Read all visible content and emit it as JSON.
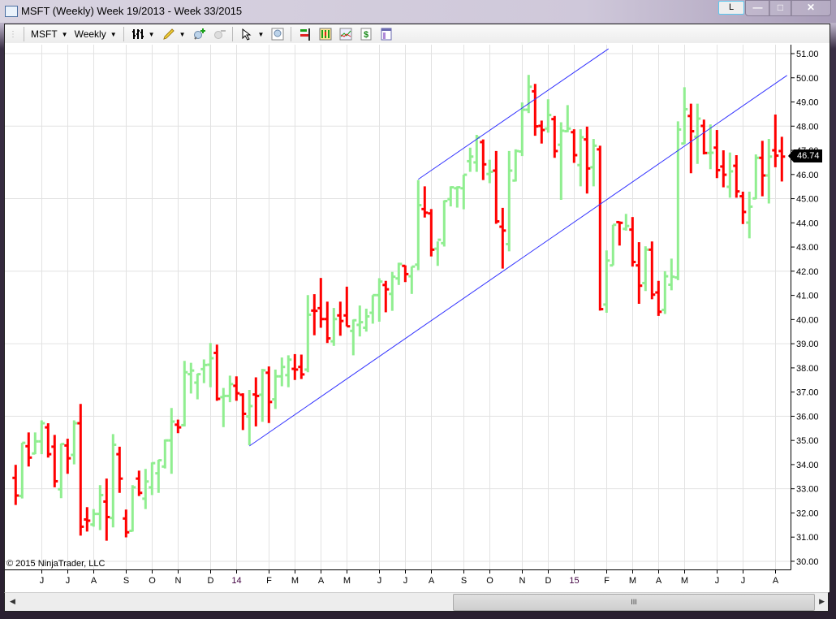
{
  "window": {
    "title": "MSFT (Weekly)  Week 19/2013 - Week 33/2015",
    "l_button": "L",
    "minimize": "—",
    "maximize": "□",
    "close": "✕"
  },
  "toolbar": {
    "instrument": "MSFT",
    "period": "Weekly",
    "icons": [
      "bar-type-icon",
      "pencil-draw-icon",
      "zoom-in-icon",
      "zoom-out-icon",
      "cursor-icon",
      "zoom-box-icon",
      "indicators-icon",
      "strategies-icon",
      "chart-style-icon",
      "dollar-icon",
      "properties-icon"
    ]
  },
  "copyright": "© 2015 NinjaTrader, LLC",
  "scroll_thumb": "III",
  "colors": {
    "up": "#90EE90",
    "down": "#FF0000",
    "trendline": "#3333FF",
    "grid": "#E2E2E2"
  },
  "chart_data": {
    "type": "ohlc",
    "symbol": "MSFT",
    "interval": "Weekly",
    "range": "Week 19/2013 - Week 33/2015",
    "last_price": "46.74",
    "ylim": [
      30,
      51
    ],
    "y_ticks": [
      "30.00",
      "31.00",
      "32.00",
      "33.00",
      "34.00",
      "35.00",
      "36.00",
      "37.00",
      "38.00",
      "39.00",
      "40.00",
      "41.00",
      "42.00",
      "43.00",
      "44.00",
      "45.00",
      "46.00",
      "47.00",
      "48.00",
      "49.00",
      "50.00",
      "51.00"
    ],
    "grid": true,
    "x_ticks": [
      {
        "label": "J",
        "bar": 4
      },
      {
        "label": "J",
        "bar": 8
      },
      {
        "label": "A",
        "bar": 12
      },
      {
        "label": "S",
        "bar": 17
      },
      {
        "label": "O",
        "bar": 21
      },
      {
        "label": "N",
        "bar": 25
      },
      {
        "label": "D",
        "bar": 30
      },
      {
        "label": "14",
        "bar": 34
      },
      {
        "label": "F",
        "bar": 39
      },
      {
        "label": "M",
        "bar": 43
      },
      {
        "label": "A",
        "bar": 47
      },
      {
        "label": "M",
        "bar": 51
      },
      {
        "label": "J",
        "bar": 56
      },
      {
        "label": "J",
        "bar": 60
      },
      {
        "label": "A",
        "bar": 64
      },
      {
        "label": "S",
        "bar": 69
      },
      {
        "label": "O",
        "bar": 73
      },
      {
        "label": "N",
        "bar": 78
      },
      {
        "label": "D",
        "bar": 82
      },
      {
        "label": "15",
        "bar": 86
      },
      {
        "label": "F",
        "bar": 91
      },
      {
        "label": "M",
        "bar": 95
      },
      {
        "label": "A",
        "bar": 99
      },
      {
        "label": "M",
        "bar": 103
      },
      {
        "label": "J",
        "bar": 108
      },
      {
        "label": "J",
        "bar": 112
      },
      {
        "label": "A",
        "bar": 117
      }
    ],
    "ohlc_fields": [
      "open",
      "high",
      "low",
      "close"
    ],
    "bars": [
      [
        33.45,
        33.99,
        32.33,
        32.72
      ],
      [
        32.7,
        34.9,
        32.6,
        34.9
      ],
      [
        34.76,
        35.33,
        33.92,
        34.29
      ],
      [
        34.46,
        35.33,
        34.43,
        34.96
      ],
      [
        34.96,
        35.83,
        34.43,
        35.71
      ],
      [
        35.54,
        35.71,
        34.29,
        34.43
      ],
      [
        34.74,
        35.23,
        33.06,
        33.31
      ],
      [
        32.98,
        34.87,
        32.61,
        34.85
      ],
      [
        34.79,
        35.07,
        33.62,
        34.26
      ],
      [
        34.4,
        35.83,
        34.01,
        35.71
      ],
      [
        35.71,
        36.51,
        31.06,
        31.43
      ],
      [
        31.73,
        32.24,
        31.23,
        31.68
      ],
      [
        31.52,
        32.16,
        31.43,
        31.96
      ],
      [
        31.96,
        33.15,
        31.29,
        32.74
      ],
      [
        32.47,
        33.42,
        30.85,
        31.83
      ],
      [
        31.79,
        35.26,
        31.4,
        34.82
      ],
      [
        34.43,
        34.74,
        32.83,
        33.42
      ],
      [
        31.77,
        32.14,
        30.99,
        31.2
      ],
      [
        31.26,
        33.15,
        31.23,
        33.06
      ],
      [
        33.42,
        33.75,
        32.7,
        32.83
      ],
      [
        32.59,
        33.82,
        32.16,
        33.3
      ],
      [
        33.06,
        34.09,
        32.74,
        34.06
      ],
      [
        33.64,
        34.2,
        32.83,
        34.18
      ],
      [
        33.92,
        35.04,
        33.84,
        35.0
      ],
      [
        35.0,
        36.34,
        33.62,
        35.78
      ],
      [
        35.65,
        35.86,
        35.3,
        35.54
      ],
      [
        35.63,
        38.29,
        35.58,
        37.82
      ],
      [
        37.74,
        38.21,
        36.94,
        37.89
      ],
      [
        37.39,
        37.76,
        36.7,
        37.74
      ],
      [
        37.95,
        38.35,
        37.37,
        38.12
      ],
      [
        38.13,
        39.03,
        37.2,
        38.4
      ],
      [
        38.62,
        38.96,
        36.64,
        36.72
      ],
      [
        36.79,
        37.17,
        35.55,
        36.84
      ],
      [
        36.84,
        37.68,
        36.58,
        37.33
      ],
      [
        37.26,
        37.65,
        36.64,
        36.95
      ],
      [
        36.89,
        36.95,
        35.43,
        36.1
      ],
      [
        35.99,
        37.09,
        34.8,
        36.42
      ],
      [
        36.9,
        37.61,
        35.58,
        36.84
      ],
      [
        36.89,
        37.96,
        35.77,
        37.9
      ],
      [
        37.8,
        38.06,
        35.72,
        36.59
      ],
      [
        36.7,
        37.93,
        36.3,
        37.65
      ],
      [
        37.65,
        38.43,
        37.24,
        38.04
      ],
      [
        37.7,
        38.52,
        37.2,
        38.34
      ],
      [
        37.96,
        38.57,
        37.5,
        37.93
      ],
      [
        38.04,
        38.55,
        37.54,
        37.73
      ],
      [
        37.93,
        41.01,
        37.82,
        40.2
      ],
      [
        40.37,
        41.05,
        39.35,
        40.36
      ],
      [
        40.47,
        41.72,
        39.66,
        40.02
      ],
      [
        40.02,
        40.74,
        39.03,
        39.22
      ],
      [
        39.1,
        40.48,
        38.91,
        40.02
      ],
      [
        40.17,
        40.74,
        39.33,
        39.94
      ],
      [
        40.17,
        41.36,
        39.72,
        39.72
      ],
      [
        39.53,
        40.0,
        38.52,
        39.97
      ],
      [
        39.78,
        40.58,
        39.3,
        39.89
      ],
      [
        39.66,
        40.45,
        39.5,
        40.13
      ],
      [
        40.28,
        41.01,
        39.83,
        41.01
      ],
      [
        41.01,
        41.71,
        39.91,
        41.57
      ],
      [
        41.43,
        41.6,
        40.3,
        41.25
      ],
      [
        41.06,
        41.97,
        40.36,
        41.77
      ],
      [
        41.7,
        42.35,
        41.43,
        42.3
      ],
      [
        42.22,
        42.24,
        41.55,
        41.88
      ],
      [
        41.79,
        42.19,
        41.06,
        42.19
      ],
      [
        42.27,
        45.77,
        42.04,
        44.73
      ],
      [
        44.57,
        45.51,
        44.22,
        44.42
      ],
      [
        44.39,
        44.57,
        42.61,
        42.89
      ],
      [
        42.93,
        43.23,
        42.22,
        43.3
      ],
      [
        43.16,
        44.93,
        43.02,
        44.9
      ],
      [
        44.98,
        45.51,
        44.68,
        45.47
      ],
      [
        45.43,
        45.51,
        44.63,
        45.47
      ],
      [
        45.43,
        45.99,
        44.56,
        45.99
      ],
      [
        46.55,
        47.11,
        46.11,
        46.74
      ],
      [
        46.5,
        47.64,
        46.11,
        47.53
      ],
      [
        47.34,
        47.45,
        45.77,
        46.42
      ],
      [
        46.02,
        46.61,
        45.64,
        46.11
      ],
      [
        46.16,
        46.97,
        43.96,
        44.06
      ],
      [
        43.84,
        44.62,
        42.11,
        43.68
      ],
      [
        43.12,
        46.97,
        42.82,
        46.16
      ],
      [
        45.75,
        47.04,
        45.71,
        46.97
      ],
      [
        46.95,
        48.98,
        46.76,
        48.68
      ],
      [
        48.68,
        50.12,
        48.54,
        49.63
      ],
      [
        49.44,
        49.75,
        47.6,
        47.99
      ],
      [
        48.01,
        48.23,
        47.28,
        47.84
      ],
      [
        47.9,
        49.11,
        47.73,
        48.46
      ],
      [
        48.29,
        48.42,
        46.69,
        46.97
      ],
      [
        47.23,
        48.16,
        44.95,
        47.81
      ],
      [
        47.79,
        48.87,
        47.75,
        47.9
      ],
      [
        47.75,
        47.87,
        46.48,
        46.8
      ],
      [
        46.39,
        47.87,
        45.51,
        47.54
      ],
      [
        47.45,
        47.98,
        45.21,
        46.25
      ],
      [
        46.3,
        47.47,
        45.51,
        47.19
      ],
      [
        47.04,
        47.19,
        40.37,
        40.43
      ],
      [
        40.62,
        42.86,
        40.28,
        42.44
      ],
      [
        42.24,
        43.92,
        42.24,
        43.92
      ],
      [
        44.03,
        44.06,
        43.06,
        44.0
      ],
      [
        43.75,
        44.37,
        43.68,
        43.87
      ],
      [
        43.72,
        44.24,
        42.19,
        42.38
      ],
      [
        42.24,
        43.2,
        40.65,
        41.4
      ],
      [
        41.51,
        43.03,
        41.18,
        42.89
      ],
      [
        42.89,
        43.23,
        40.84,
        41.03
      ],
      [
        41.12,
        41.6,
        40.15,
        40.32
      ],
      [
        40.4,
        42.0,
        40.23,
        41.79
      ],
      [
        41.44,
        42.52,
        41.21,
        41.77
      ],
      [
        41.74,
        48.2,
        41.63,
        47.86
      ],
      [
        47.28,
        49.61,
        47.26,
        48.7
      ],
      [
        48.42,
        48.93,
        46.05,
        47.79
      ],
      [
        47.56,
        48.93,
        46.44,
        48.31
      ],
      [
        48.01,
        48.27,
        46.83,
        46.89
      ],
      [
        46.89,
        48.07,
        46.22,
        46.9
      ],
      [
        47.11,
        47.84,
        45.85,
        46.18
      ],
      [
        46.33,
        47.0,
        45.47,
        45.99
      ],
      [
        45.49,
        46.91,
        45.04,
        46.13
      ],
      [
        46.36,
        46.8,
        45.04,
        45.3
      ],
      [
        45.1,
        45.29,
        43.95,
        44.45
      ],
      [
        44.01,
        45.29,
        43.36,
        44.67
      ],
      [
        45.01,
        46.83,
        44.98,
        46.69
      ],
      [
        46.69,
        47.39,
        45.1,
        45.96
      ],
      [
        45.96,
        47.47,
        44.8,
        46.74
      ],
      [
        47.0,
        48.48,
        46.3,
        46.78
      ],
      [
        46.97,
        47.56,
        45.71,
        46.74
      ]
    ],
    "trendlines": [
      {
        "name": "lower-channel-line",
        "bar1": 36,
        "price1": 34.77,
        "bar2": 118.8,
        "price2": 50.1
      },
      {
        "name": "upper-channel-line",
        "bar1": 62,
        "price1": 45.8,
        "bar2": 91.3,
        "price2": 51.2
      }
    ]
  }
}
